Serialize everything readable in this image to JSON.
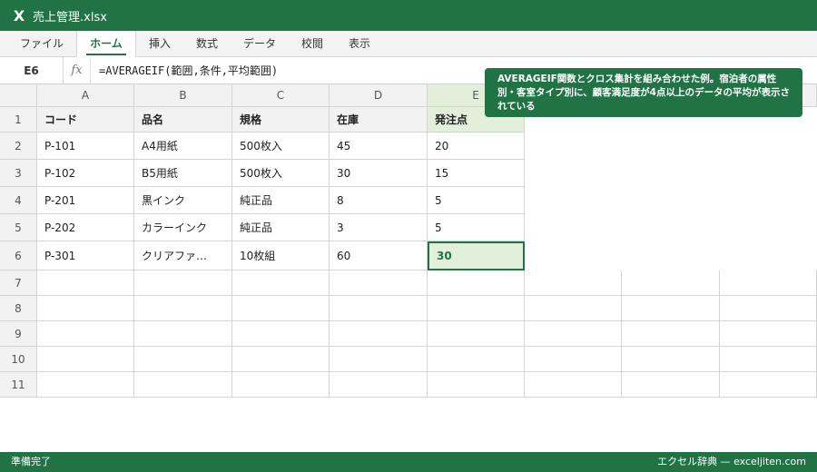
{
  "window": {
    "app_icon": "X",
    "title": "売上管理.xlsx"
  },
  "ribbon": {
    "tabs": [
      "ファイル",
      "ホーム",
      "挿入",
      "数式",
      "データ",
      "校閲",
      "表示"
    ],
    "active": "ホーム"
  },
  "formula_bar": {
    "cell_ref": "E6",
    "fx_label": "fx",
    "formula": "=AVERAGEIF(範囲,条件,平均範囲)"
  },
  "tooltip": {
    "text": "AVERAGEIF関数とクロス集計を組み合わせた例。宿泊者の属性別・客室タイプ別に、顧客満足度が4点以上のデータの平均が表示されている"
  },
  "sheet": {
    "columns": [
      "A",
      "B",
      "C",
      "D",
      "E"
    ],
    "row_numbers": [
      "1",
      "2",
      "3",
      "4",
      "5",
      "6",
      "7",
      "8",
      "9",
      "10",
      "11"
    ],
    "header": [
      "コード",
      "品名",
      "規格",
      "在庫",
      "発注点"
    ],
    "rows": [
      [
        "P-101",
        "A4用紙",
        "500枚入",
        "45",
        "20"
      ],
      [
        "P-102",
        "B5用紙",
        "500枚入",
        "30",
        "15"
      ],
      [
        "P-201",
        "黒インク",
        "純正品",
        "8",
        "5"
      ],
      [
        "P-202",
        "カラーインク",
        "純正品",
        "3",
        "5"
      ],
      [
        "P-301",
        "クリアファ…",
        "10枚組",
        "60",
        "30"
      ]
    ]
  },
  "status": {
    "left": "準備完了",
    "right": "エクセル辞典 — exceljiten.com"
  },
  "colors": {
    "accent": "#217346",
    "highlight": "#e2efda"
  }
}
